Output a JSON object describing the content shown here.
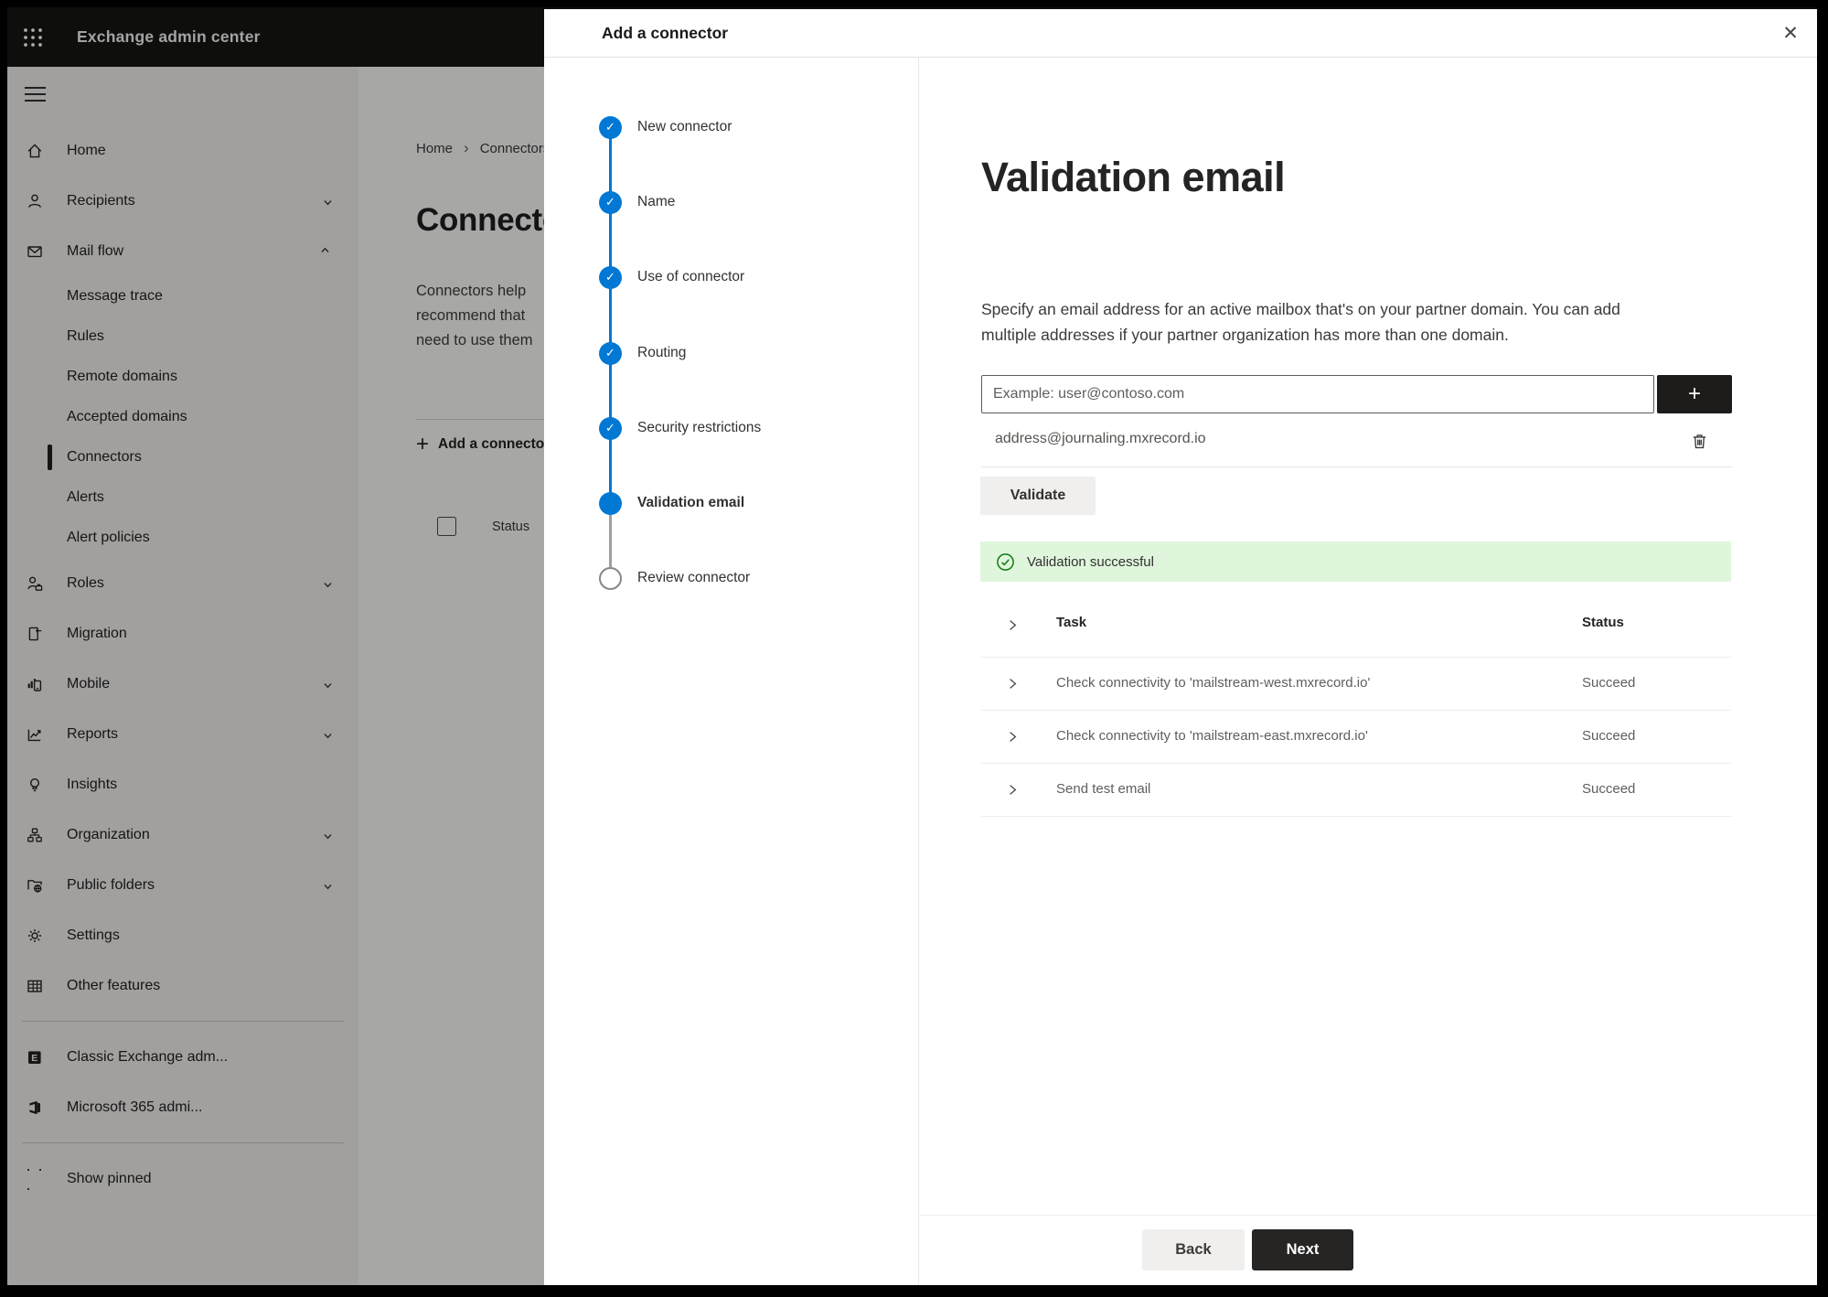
{
  "app": {
    "title": "Exchange admin center"
  },
  "icons": {
    "check": "✓",
    "plus": "+",
    "close": "✕",
    "breadcrumb_sep": "›",
    "ellipsis": "· · ·"
  },
  "sidebar": {
    "items": [
      {
        "label": "Home",
        "icon": "home"
      },
      {
        "label": "Recipients",
        "icon": "person",
        "chevron": "down"
      },
      {
        "label": "Mail flow",
        "icon": "mail",
        "chevron": "up"
      },
      {
        "label": "Message trace",
        "indent": true
      },
      {
        "label": "Rules",
        "indent": true
      },
      {
        "label": "Remote domains",
        "indent": true
      },
      {
        "label": "Accepted domains",
        "indent": true
      },
      {
        "label": "Connectors",
        "indent": true,
        "selected": true
      },
      {
        "label": "Alerts",
        "indent": true
      },
      {
        "label": "Alert policies",
        "indent": true
      },
      {
        "label": "Roles",
        "icon": "roles",
        "chevron": "down"
      },
      {
        "label": "Migration",
        "icon": "migration"
      },
      {
        "label": "Mobile",
        "icon": "mobile",
        "chevron": "down"
      },
      {
        "label": "Reports",
        "icon": "reports",
        "chevron": "down"
      },
      {
        "label": "Insights",
        "icon": "insights"
      },
      {
        "label": "Organization",
        "icon": "organization",
        "chevron": "down"
      },
      {
        "label": "Public folders",
        "icon": "folders",
        "chevron": "down"
      },
      {
        "label": "Settings",
        "icon": "settings"
      },
      {
        "label": "Other features",
        "icon": "grid"
      },
      {
        "divider": true
      },
      {
        "label": "Classic Exchange adm...",
        "icon": "exchange"
      },
      {
        "label": "Microsoft 365 admi...",
        "icon": "office"
      },
      {
        "divider": true
      },
      {
        "label": "Show pinned",
        "icon": "ellipsis"
      }
    ]
  },
  "background_page": {
    "breadcrumb": {
      "home": "Home",
      "current": "Connectors"
    },
    "page_title": "Connectors",
    "description_lines": [
      "Connectors help",
      "recommend that",
      "need to use them"
    ],
    "add_button_label": "Add a connector",
    "list_header": "Status"
  },
  "panel": {
    "title": "Add a connector",
    "steps": [
      {
        "label": "New connector",
        "state": "done"
      },
      {
        "label": "Name",
        "state": "done"
      },
      {
        "label": "Use of connector",
        "state": "done"
      },
      {
        "label": "Routing",
        "state": "done"
      },
      {
        "label": "Security restrictions",
        "state": "done"
      },
      {
        "label": "Validation email",
        "state": "current"
      },
      {
        "label": "Review connector",
        "state": "todo"
      }
    ],
    "content": {
      "heading": "Validation email",
      "description_lines": [
        "Specify an email address for an active mailbox that's on your partner domain. You can add",
        "multiple addresses if your partner organization has more than one domain."
      ],
      "email_placeholder": "Example: user@contoso.com",
      "added_address": "address@journaling.mxrecord.io",
      "validate_button": "Validate",
      "success_message": "Validation successful",
      "table": {
        "task_column": "Task",
        "status_column": "Status",
        "rows": [
          {
            "task": "Check connectivity to 'mailstream-west.mxrecord.io'",
            "status": "Succeed"
          },
          {
            "task": "Check connectivity to 'mailstream-east.mxrecord.io'",
            "status": "Succeed"
          },
          {
            "task": "Send test email",
            "status": "Succeed"
          }
        ]
      }
    },
    "footer": {
      "back": "Back",
      "next": "Next"
    }
  },
  "colors": {
    "accent": "#0078d4",
    "success_green": "#107c10",
    "success_bg": "#dff6dd"
  }
}
